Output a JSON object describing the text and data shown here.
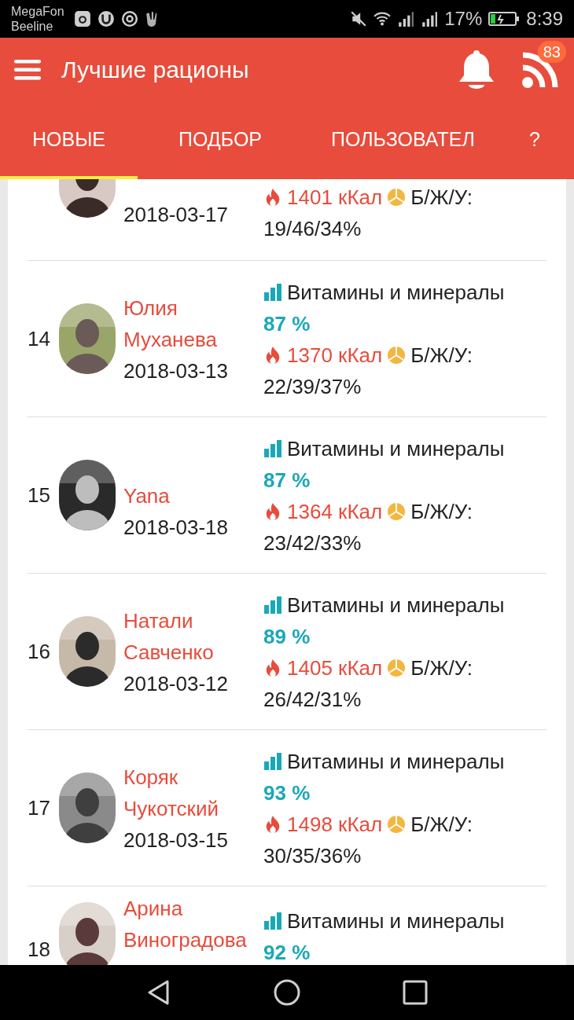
{
  "status_bar": {
    "carriers": [
      "MegaFon",
      "Beeline"
    ],
    "battery_percent": "17%",
    "time": "8:39"
  },
  "app_bar": {
    "title": "Лучшие рационы",
    "badge": "83"
  },
  "tabs": [
    {
      "label": "НОВЫЕ",
      "selected": true
    },
    {
      "label": "ПОДБОР",
      "selected": false
    },
    {
      "label": "ПОЛЬЗОВАТЕЛ",
      "selected": false
    },
    {
      "label": "?",
      "selected": false
    }
  ],
  "rows": [
    {
      "date": "2018-03-17",
      "kcal": "1401 кКал",
      "bju_label": "Б/Ж/У:",
      "bju_value": "19/46/34%"
    },
    {
      "rank": "14",
      "name": "Юлия Муханева",
      "date": "2018-03-13",
      "vitamins_label": "Витамины и минералы",
      "vitamins_percent": "87 %",
      "kcal": "1370 кКал",
      "bju_label": "Б/Ж/У:",
      "bju_value": "22/39/37%"
    },
    {
      "rank": "15",
      "name": "Yana",
      "date": "2018-03-18",
      "vitamins_label": "Витамины и минералы",
      "vitamins_percent": "87 %",
      "kcal": "1364 кКал",
      "bju_label": "Б/Ж/У:",
      "bju_value": "23/42/33%"
    },
    {
      "rank": "16",
      "name": "Натали Савченко",
      "date": "2018-03-12",
      "vitamins_label": "Витамины и минералы",
      "vitamins_percent": "89 %",
      "kcal": "1405 кКал",
      "bju_label": "Б/Ж/У:",
      "bju_value": "26/42/31%"
    },
    {
      "rank": "17",
      "name": "Коряк Чукотский",
      "date": "2018-03-15",
      "vitamins_label": "Витамины и минералы",
      "vitamins_percent": "93 %",
      "kcal": "1498 кКал",
      "bju_label": "Б/Ж/У:",
      "bju_value": "30/35/36%"
    },
    {
      "rank": "18",
      "name": "Арина Виноградова",
      "vitamins_label": "Витамины и минералы",
      "vitamins_percent": "92 %"
    }
  ]
}
